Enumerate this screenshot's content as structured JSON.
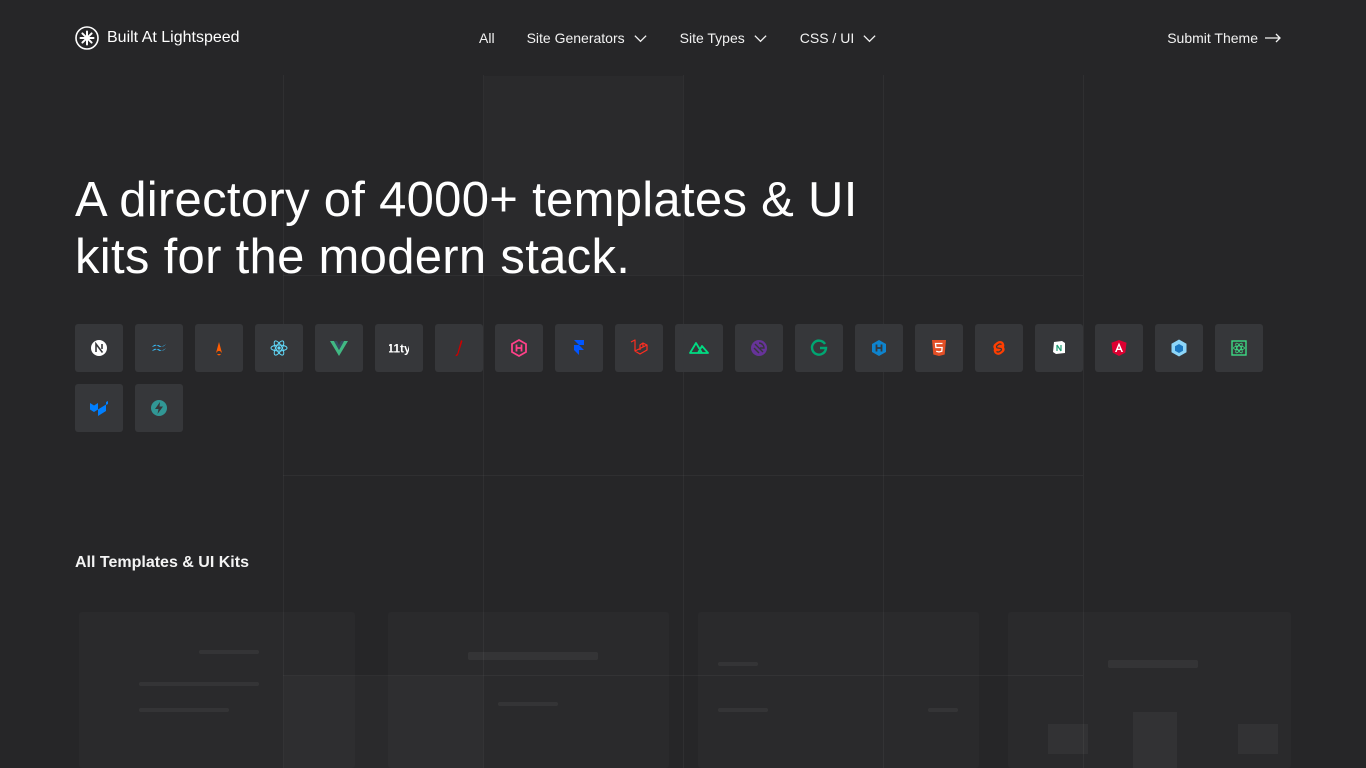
{
  "header": {
    "logo_text": "Built At Lightspeed",
    "nav": [
      {
        "label": "All",
        "dropdown": false
      },
      {
        "label": "Site Generators",
        "dropdown": true
      },
      {
        "label": "Site Types",
        "dropdown": true
      },
      {
        "label": "CSS / UI",
        "dropdown": true
      }
    ],
    "submit_label": "Submit Theme"
  },
  "hero": {
    "line1": "A directory of 4000+ templates & UI",
    "line2": "kits for the modern stack."
  },
  "technologies": [
    {
      "icon": "nextjs-icon",
      "color": "#ffffff"
    },
    {
      "icon": "tailwind-icon",
      "color": "#38bdf8"
    },
    {
      "icon": "astro-icon",
      "color": "#ff5d01"
    },
    {
      "icon": "react-icon",
      "color": "#61dafb"
    },
    {
      "icon": "vue-icon",
      "color": "#41b883"
    },
    {
      "icon": "eleventy-icon",
      "color": "#ffffff"
    },
    {
      "icon": "jekyll-icon",
      "color": "#cc0000"
    },
    {
      "icon": "hugo-icon",
      "color": "#ff4088"
    },
    {
      "icon": "framer-icon",
      "color": "#0055ff"
    },
    {
      "icon": "laravel-icon",
      "color": "#ff2d20"
    },
    {
      "icon": "nuxt-icon",
      "color": "#00dc82"
    },
    {
      "icon": "gatsby-icon",
      "color": "#663399"
    },
    {
      "icon": "gridsome-icon",
      "color": "#00a672"
    },
    {
      "icon": "hexo-icon",
      "color": "#0e83cd"
    },
    {
      "icon": "html5-icon",
      "color": "#e34f26"
    },
    {
      "icon": "svelte-icon",
      "color": "#ff3e00"
    },
    {
      "icon": "notion-icon",
      "color": "#ffffff"
    },
    {
      "icon": "angular-icon",
      "color": "#dd0031"
    },
    {
      "icon": "webpack-icon",
      "color": "#8dd6f9"
    },
    {
      "icon": "react-native-icon",
      "color": "#3ddc84"
    },
    {
      "icon": "mui-icon",
      "color": "#007fff"
    },
    {
      "icon": "chakra-bolt-icon",
      "color": "#319795"
    }
  ],
  "section": {
    "title": "All Templates & UI Kits"
  }
}
